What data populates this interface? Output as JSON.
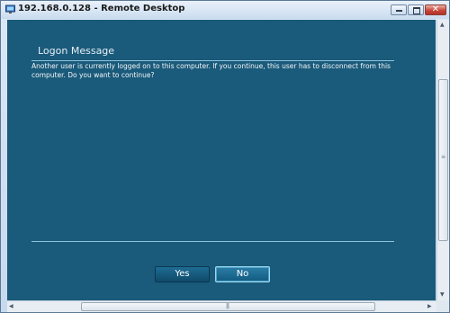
{
  "window": {
    "title": "192.168.0.128 - Remote Desktop",
    "icon": "remote-desktop-icon",
    "controls": {
      "minimize": "minimize-icon",
      "maximize": "maximize-icon",
      "close_glyph": "✕"
    }
  },
  "dialog": {
    "title": "Logon Message",
    "message": "Another user is currently logged on to this computer. If you continue, this user has to disconnect from this computer. Do you want to continue?",
    "buttons": {
      "yes": "Yes",
      "no": "No"
    }
  },
  "scrollbars": {
    "vertical_grip": "≡",
    "horizontal_grip": "|||",
    "arrows": {
      "up": "▲",
      "down": "▼",
      "left": "◀",
      "right": "▶"
    }
  },
  "colors": {
    "content_background": "#1a5a7a",
    "rule": "#8fc3dc",
    "selected_button_border": "#9fd8f0"
  }
}
